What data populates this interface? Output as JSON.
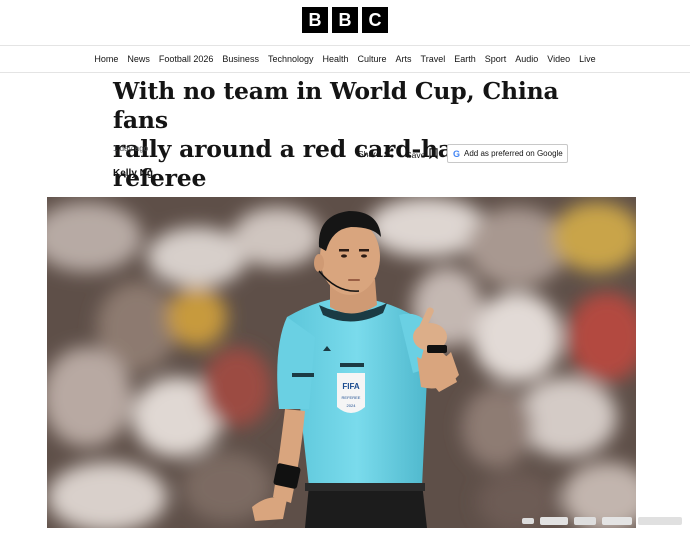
{
  "logo": {
    "letters": [
      "B",
      "B",
      "C"
    ]
  },
  "nav": {
    "items": [
      "Home",
      "News",
      "Football 2026",
      "Business",
      "Technology",
      "Health",
      "Culture",
      "Arts",
      "Travel",
      "Earth",
      "Sport",
      "Audio",
      "Video",
      "Live"
    ]
  },
  "article": {
    "headline_line1": "With no team in World Cup, China fans",
    "headline_line2": "rally around a red card-happy referee",
    "timestamp": "1 day ago",
    "byline": "Kelly Ng",
    "share_label": "Share",
    "save_label": "Save",
    "google_label": "Add as preferred on Google"
  },
  "photo": {
    "badge_line1": "FIFA",
    "badge_line2": "REFEREE",
    "badge_year": "2024"
  },
  "colors": {
    "shirt": "#6fd3e6",
    "crowd_bg": "#6a5a52",
    "text": "#141414"
  }
}
